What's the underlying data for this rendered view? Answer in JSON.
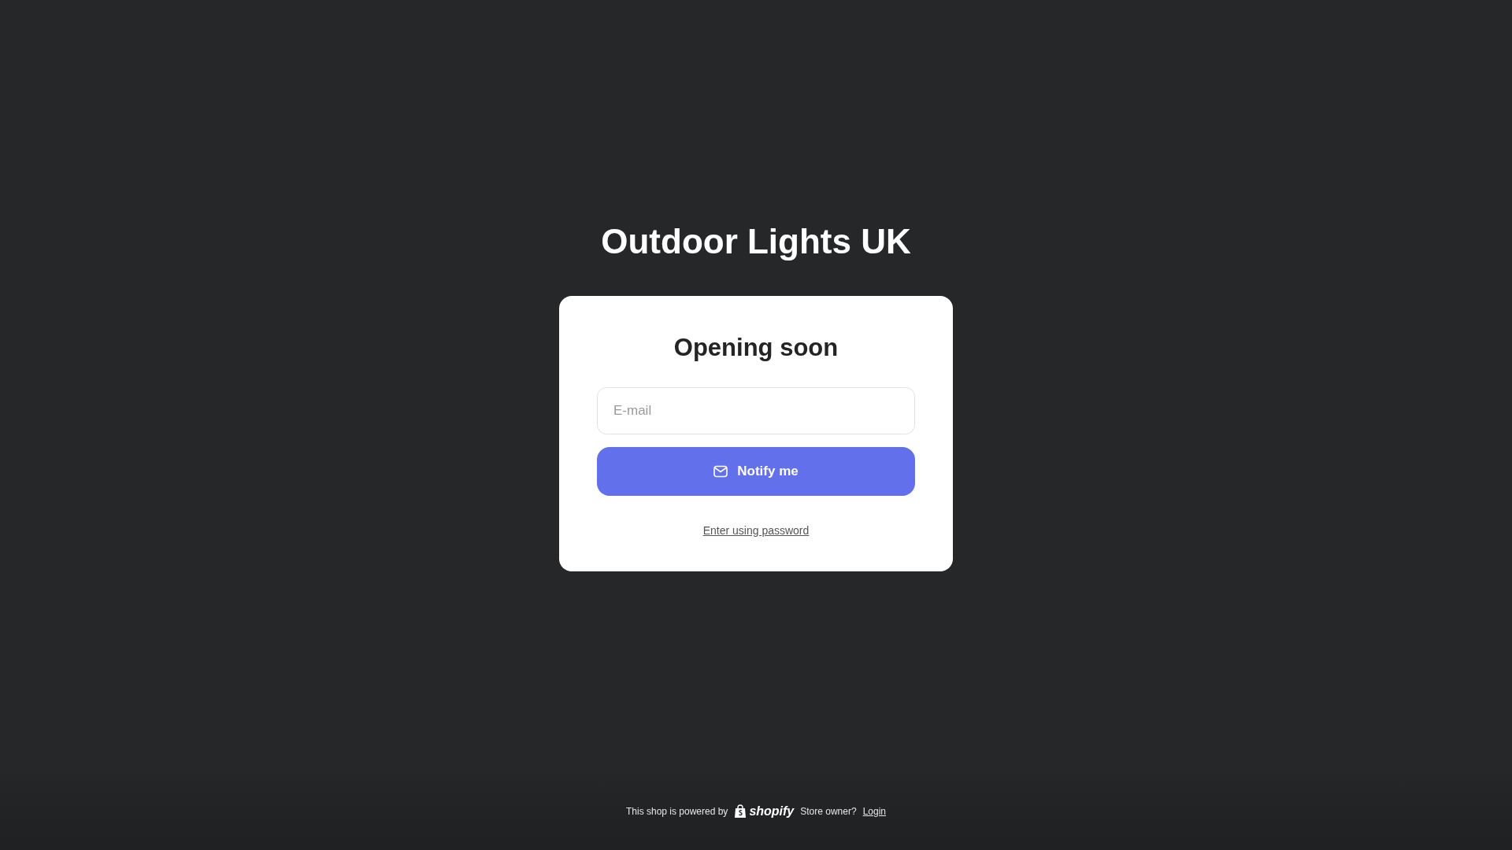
{
  "store_name": "Outdoor Lights UK",
  "card": {
    "heading": "Opening soon",
    "email": {
      "placeholder": "E-mail"
    },
    "button": "Notify me",
    "password_link": "Enter using password"
  },
  "footer": {
    "powered_text": "This shop is powered by",
    "logo_text": "shopify",
    "owner_text": "Store owner?",
    "login_link": "Login"
  }
}
